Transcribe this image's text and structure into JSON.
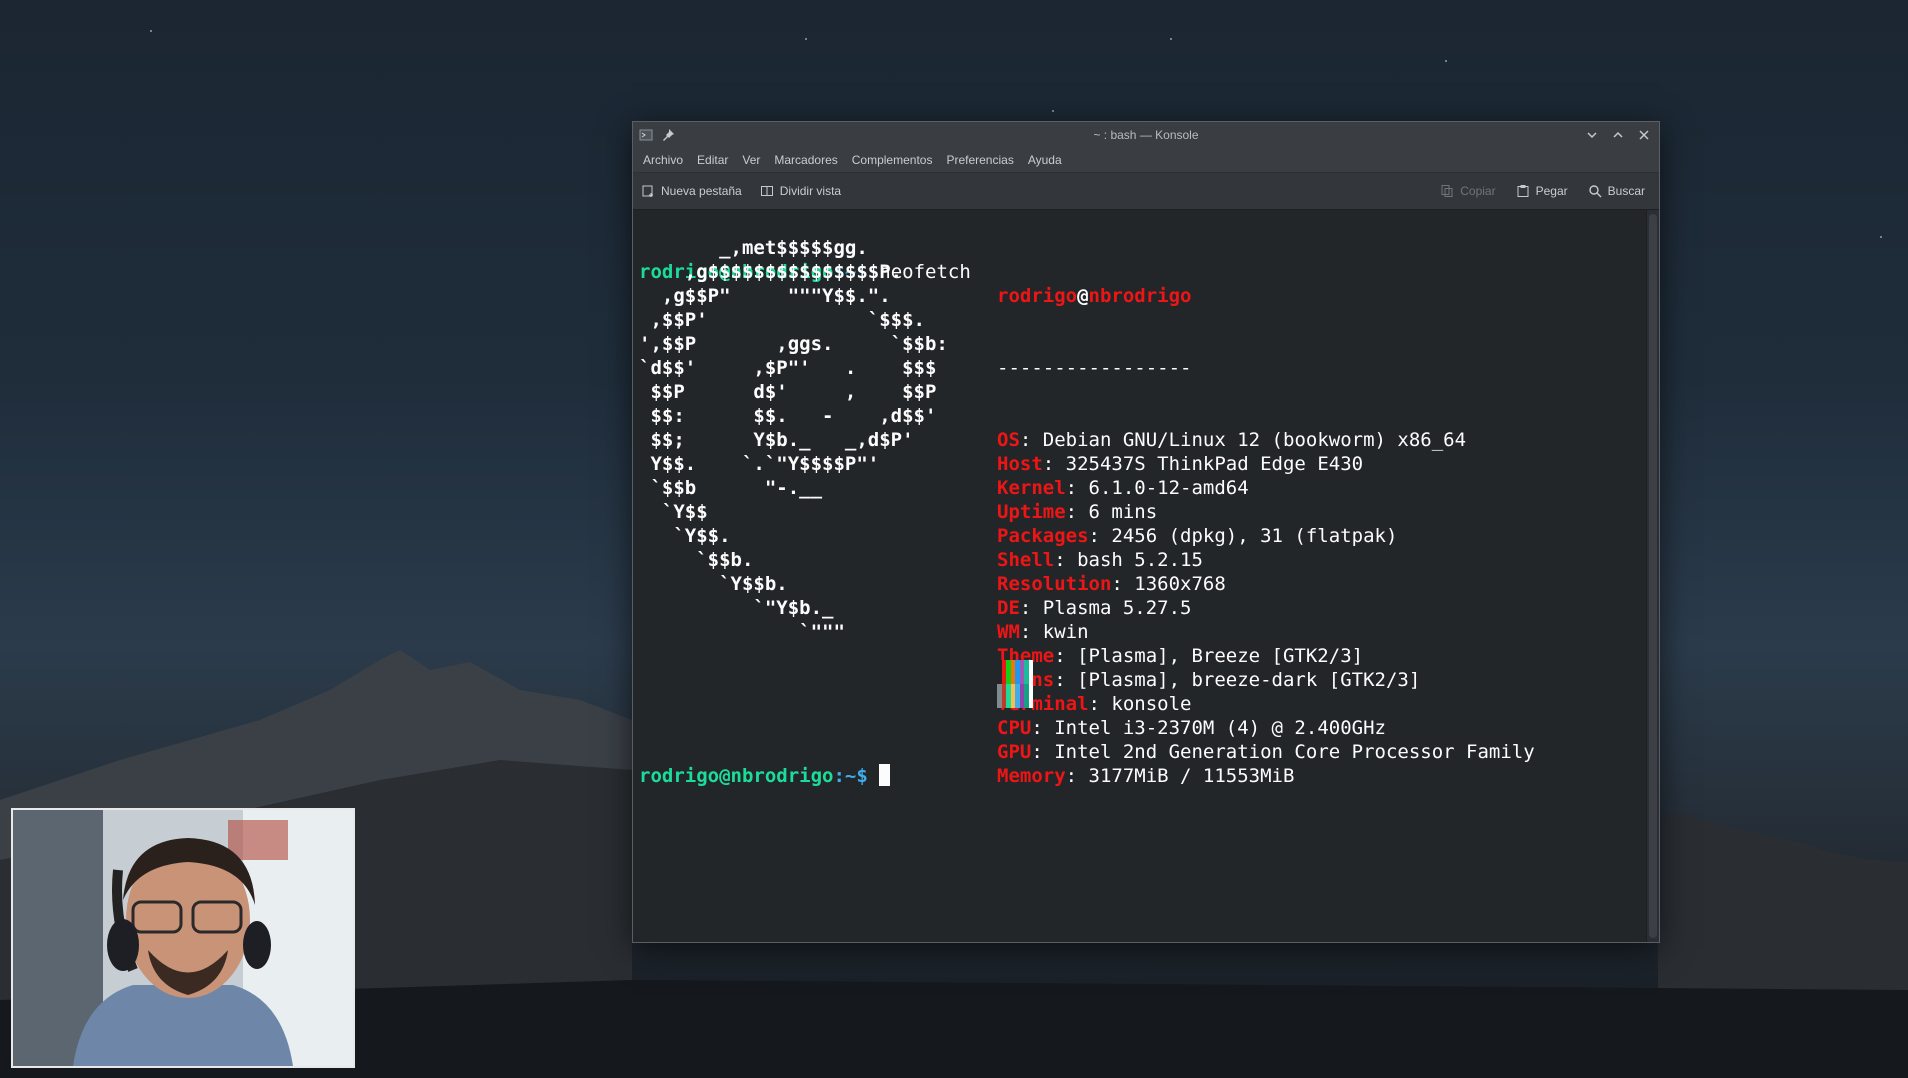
{
  "window": {
    "title": "~ : bash — Konsole",
    "menu": [
      "Archivo",
      "Editar",
      "Ver",
      "Marcadores",
      "Complementos",
      "Preferencias",
      "Ayuda"
    ],
    "toolbar": {
      "new_tab": "Nueva pestaña",
      "split_view": "Dividir vista",
      "copy": "Copiar",
      "paste": "Pegar",
      "search": "Buscar"
    }
  },
  "terminal": {
    "prompt_user": "rodrigo@nbrodrigo",
    "prompt_path": ":~$",
    "command": "neofetch",
    "logo_lines": [
      "       _,met$$$$$gg.",
      "    ,g$$$$$$$$$$$$$$$P.",
      "  ,g$$P\"     \"\"\"Y$$.\".",
      " ,$$P'              `$$$.",
      "',$$P       ,ggs.     `$$b:",
      "`d$$'     ,$P\"'   .    $$$",
      " $$P      d$'     ,    $$P",
      " $$:      $$.   -    ,d$$'",
      " $$;      Y$b._   _,d$P'",
      " Y$$.    `.`\"Y$$$$P\"'",
      " `$$b      \"-.__",
      "  `Y$$",
      "   `Y$$.",
      "     `$$b.",
      "       `Y$$b.",
      "          `\"Y$b._",
      "              `\"\"\""
    ],
    "info_user": "rodrigo",
    "info_at": "@",
    "info_host": "nbrodrigo",
    "separator": "-----------------",
    "info": [
      {
        "key": "OS",
        "value": "Debian GNU/Linux 12 (bookworm) x86_64"
      },
      {
        "key": "Host",
        "value": "325437S ThinkPad Edge E430"
      },
      {
        "key": "Kernel",
        "value": "6.1.0-12-amd64"
      },
      {
        "key": "Uptime",
        "value": "6 mins"
      },
      {
        "key": "Packages",
        "value": "2456 (dpkg), 31 (flatpak)"
      },
      {
        "key": "Shell",
        "value": "bash 5.2.15"
      },
      {
        "key": "Resolution",
        "value": "1360x768"
      },
      {
        "key": "DE",
        "value": "Plasma 5.27.5"
      },
      {
        "key": "WM",
        "value": "kwin"
      },
      {
        "key": "Theme",
        "value": "[Plasma], Breeze [GTK2/3]"
      },
      {
        "key": "Icons",
        "value": "[Plasma], breeze-dark [GTK2/3]"
      },
      {
        "key": "Terminal",
        "value": "konsole"
      },
      {
        "key": "CPU",
        "value": "Intel i3-2370M (4) @ 2.400GHz"
      },
      {
        "key": "GPU",
        "value": "Intel 2nd Generation Core Processor Family"
      },
      {
        "key": "Memory",
        "value": "3177MiB / 11553MiB"
      }
    ],
    "palette_top": [
      "#232629",
      "#ed1515",
      "#11d116",
      "#f67400",
      "#1d99f3",
      "#9b59b6",
      "#1abc9c",
      "#fcfcfc"
    ],
    "palette_bottom": [
      "#7f8c8d",
      "#c0392b",
      "#1cdc9a",
      "#fdbc4b",
      "#3daee9",
      "#8e44ad",
      "#16a085",
      "#ffffff"
    ]
  },
  "colors": {
    "prompt_green": "#1cdc9a",
    "prompt_blue": "#3daee9",
    "info_red": "#ed1515"
  }
}
